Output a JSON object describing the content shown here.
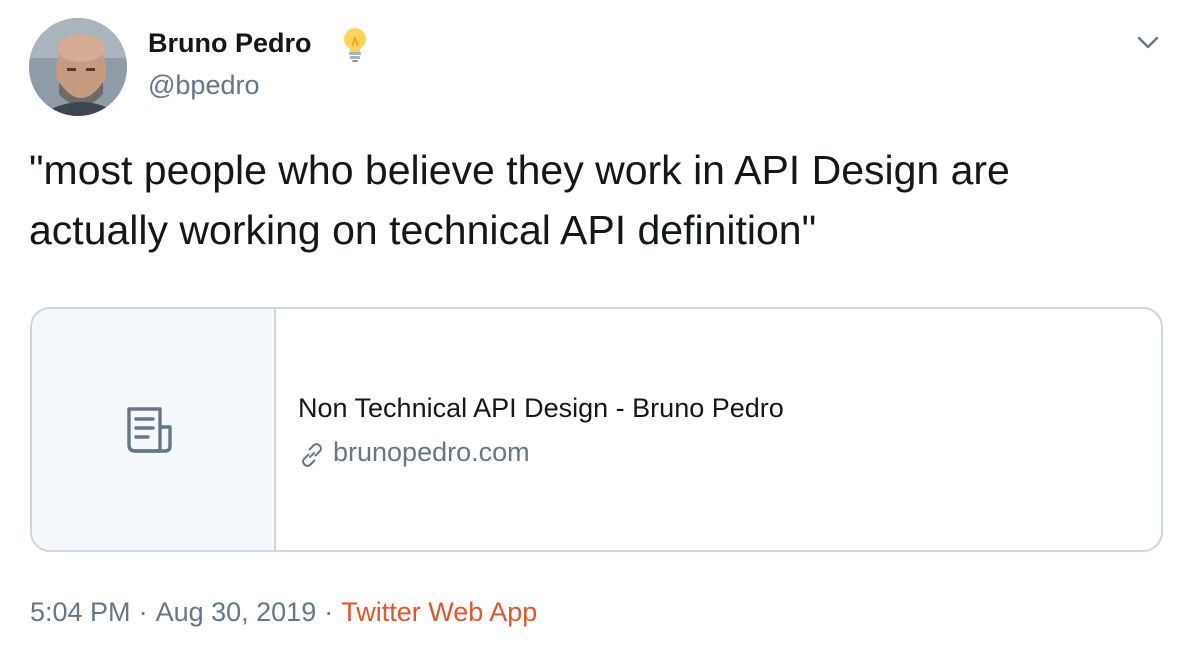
{
  "author": {
    "name": "Bruno Pedro",
    "handle": "@bpedro",
    "badge_icon": "lightbulb-icon"
  },
  "tweet": {
    "text": "\"most people who believe they work in API Design are actually working on technical API definition\""
  },
  "card": {
    "icon": "document-icon",
    "title": "Non Technical API Design - Bruno Pedro",
    "domain_icon": "link-icon",
    "domain": "brunopedro.com"
  },
  "meta": {
    "time": "5:04 PM",
    "separator": "·",
    "date": "Aug 30, 2019",
    "source": "Twitter Web App"
  },
  "colors": {
    "text": "#14171a",
    "secondary": "#657786",
    "source_link": "#e0562c",
    "card_border": "#ccd6dd",
    "card_media_bg": "#f5f8fa"
  }
}
